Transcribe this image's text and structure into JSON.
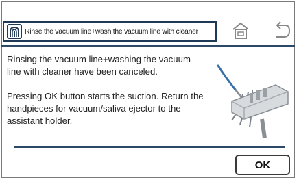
{
  "header": {
    "title": "Rinse the vacuum line+wash the vacuum line with cleaner"
  },
  "message": {
    "line1": "Rinsing the vacuum line+washing the vacuum line with cleaner have been canceled.",
    "line2": "Pressing OK button starts the suction. Return the handpieces for vacuum/saliva ejector to the assistant holder."
  },
  "buttons": {
    "ok_label": "OK"
  },
  "icons": {
    "header": "hand-vacuum-icon",
    "home": "home-icon",
    "back": "back-arrow-icon"
  },
  "colors": {
    "frame": "#1f3a56",
    "accent": "#2c4a68"
  }
}
